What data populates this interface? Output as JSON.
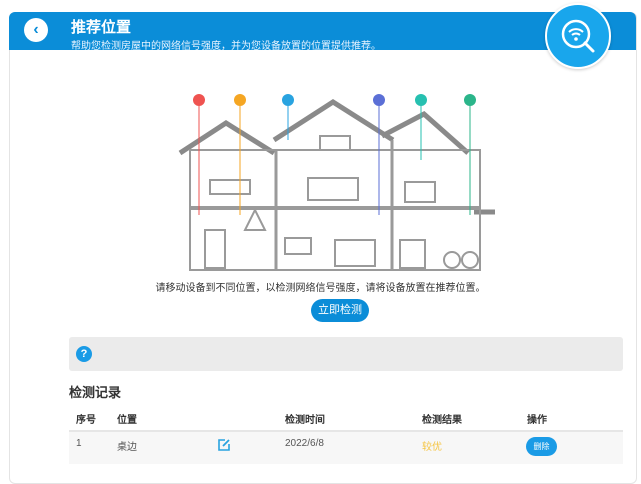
{
  "header": {
    "title": "推荐位置",
    "subtitle": "帮助您检测房屋中的网络信号强度，并为您设备放置的位置提供推荐。"
  },
  "signal_colors": [
    "#ef5350",
    "#f5a623",
    "#29a3e0",
    "#5b6fd6",
    "#26c0b0",
    "#2bb58a"
  ],
  "hint": "请移动设备到不同位置，以检测网络信号强度，请将设备放置在推荐位置。",
  "detect_button": "立即检测",
  "records": {
    "title": "检测记录",
    "columns": [
      "序号",
      "位置",
      "检测时间",
      "检测结果",
      "操作"
    ],
    "rows": [
      {
        "index": "1",
        "location": "桌边",
        "time": "2022/6/8",
        "result": "较优",
        "action": "删除"
      }
    ]
  },
  "colors": {
    "primary": "#0b8dd8",
    "result": "#f5c542"
  }
}
